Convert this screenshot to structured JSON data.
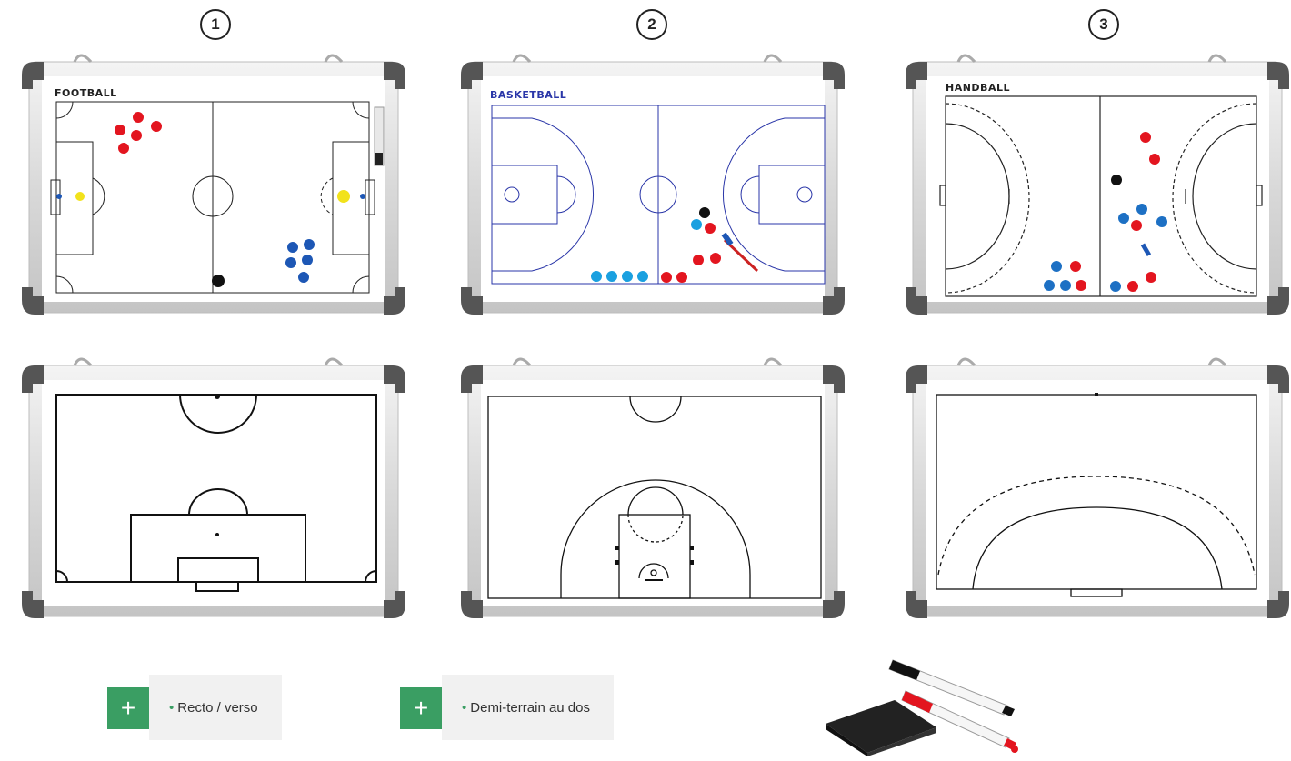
{
  "steps": [
    "1",
    "2",
    "3"
  ],
  "boards": {
    "football": {
      "label": "FOOTBALL"
    },
    "basketball": {
      "label": "BASKETBALL"
    },
    "handball": {
      "label": "HANDBALL"
    }
  },
  "features": [
    {
      "label": "Recto / verso",
      "icon": "plus-icon"
    },
    {
      "label": "Demi-terrain au dos",
      "icon": "plus-icon"
    }
  ],
  "colors": {
    "accent": "#3a9e63",
    "magnet_red": "#e3151f",
    "magnet_blue": "#1d57b5",
    "magnet_yellow": "#f2e21b",
    "basket_line": "#2a36a8"
  }
}
